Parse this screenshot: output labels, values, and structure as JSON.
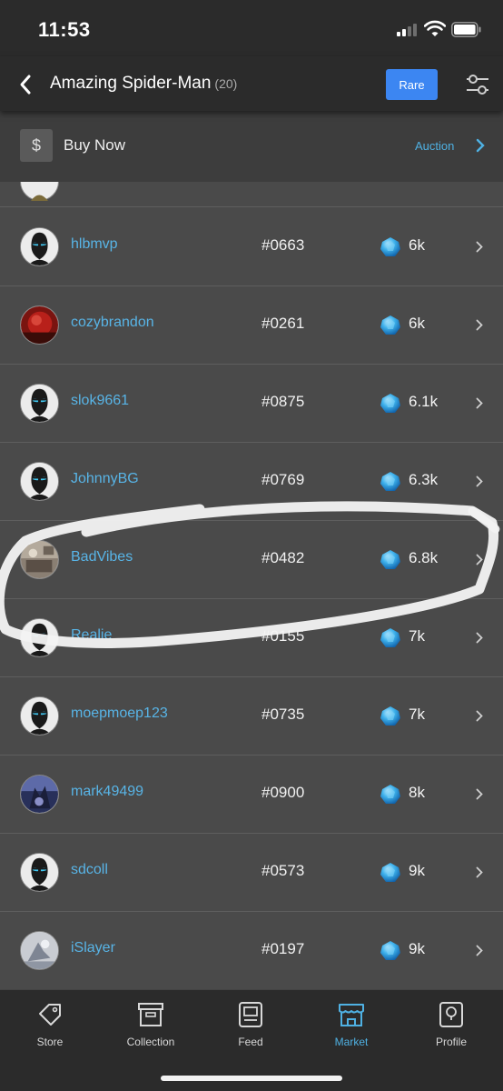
{
  "status_bar": {
    "time": "11:53"
  },
  "header": {
    "title": "Amazing Spider-Man",
    "count": "(20)",
    "rare_label": "Rare"
  },
  "buy_bar": {
    "dollar": "$",
    "buy_now_label": "Buy Now",
    "auction_label": "Auction"
  },
  "listings": [
    {
      "username": "hlbmvp",
      "serial": "#0663",
      "price": "6k",
      "avatar": "mask-icon"
    },
    {
      "username": "cozybrandon",
      "serial": "#0261",
      "price": "6k",
      "avatar": "photo-red"
    },
    {
      "username": "slok9661",
      "serial": "#0875",
      "price": "6.1k",
      "avatar": "mask-icon"
    },
    {
      "username": "JohnnyBG",
      "serial": "#0769",
      "price": "6.3k",
      "avatar": "mask-icon"
    },
    {
      "username": "BadVibes",
      "serial": "#0482",
      "price": "6.8k",
      "avatar": "photo-room"
    },
    {
      "username": "Realie",
      "serial": "#0155",
      "price": "7k",
      "avatar": "mask-icon"
    },
    {
      "username": "moepmoep123",
      "serial": "#0735",
      "price": "7k",
      "avatar": "mask-icon"
    },
    {
      "username": "mark49499",
      "serial": "#0900",
      "price": "8k",
      "avatar": "photo-blue"
    },
    {
      "username": "sdcoll",
      "serial": "#0573",
      "price": "9k",
      "avatar": "mask-icon"
    },
    {
      "username": "iSlayer",
      "serial": "#0197",
      "price": "9k",
      "avatar": "photo-grey"
    }
  ],
  "tabbar": {
    "tabs": [
      {
        "label": "Store",
        "icon": "tag-icon",
        "active": false
      },
      {
        "label": "Collection",
        "icon": "archive-box-icon",
        "active": false
      },
      {
        "label": "Feed",
        "icon": "feed-icon",
        "active": false
      },
      {
        "label": "Market",
        "icon": "storefront-icon",
        "active": true
      },
      {
        "label": "Profile",
        "icon": "profile-icon",
        "active": false
      }
    ]
  },
  "colors": {
    "accent_blue": "#4fb1e3",
    "rare_button": "#3c86f2",
    "background": "#4a4a4a",
    "bar_background": "#2b2b2b"
  }
}
